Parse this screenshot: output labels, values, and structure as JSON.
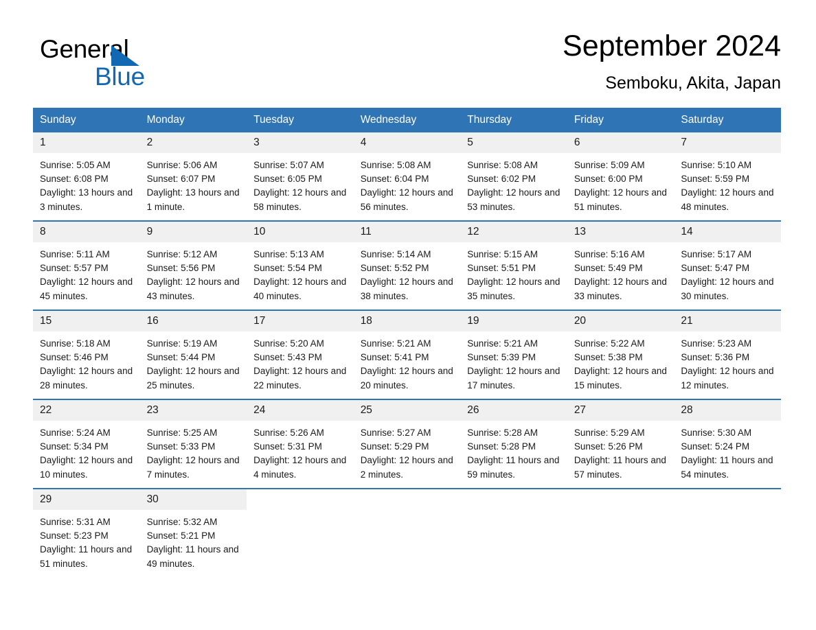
{
  "brand": {
    "name_part1": "General",
    "name_part2": "Blue",
    "triangle_icon": "triangle-icon",
    "accent_color": "#1268b3"
  },
  "header": {
    "title": "September 2024",
    "location": "Semboku, Akita, Japan"
  },
  "theme": {
    "header_bg": "#2f74b5",
    "header_text": "#ffffff",
    "daynum_bg": "#f0f0f0",
    "separator": "#2f74b5"
  },
  "weekdays": [
    "Sunday",
    "Monday",
    "Tuesday",
    "Wednesday",
    "Thursday",
    "Friday",
    "Saturday"
  ],
  "weeks": [
    [
      {
        "day": "1",
        "sunrise": "Sunrise: 5:05 AM",
        "sunset": "Sunset: 6:08 PM",
        "daylight": "Daylight: 13 hours and 3 minutes."
      },
      {
        "day": "2",
        "sunrise": "Sunrise: 5:06 AM",
        "sunset": "Sunset: 6:07 PM",
        "daylight": "Daylight: 13 hours and 1 minute."
      },
      {
        "day": "3",
        "sunrise": "Sunrise: 5:07 AM",
        "sunset": "Sunset: 6:05 PM",
        "daylight": "Daylight: 12 hours and 58 minutes."
      },
      {
        "day": "4",
        "sunrise": "Sunrise: 5:08 AM",
        "sunset": "Sunset: 6:04 PM",
        "daylight": "Daylight: 12 hours and 56 minutes."
      },
      {
        "day": "5",
        "sunrise": "Sunrise: 5:08 AM",
        "sunset": "Sunset: 6:02 PM",
        "daylight": "Daylight: 12 hours and 53 minutes."
      },
      {
        "day": "6",
        "sunrise": "Sunrise: 5:09 AM",
        "sunset": "Sunset: 6:00 PM",
        "daylight": "Daylight: 12 hours and 51 minutes."
      },
      {
        "day": "7",
        "sunrise": "Sunrise: 5:10 AM",
        "sunset": "Sunset: 5:59 PM",
        "daylight": "Daylight: 12 hours and 48 minutes."
      }
    ],
    [
      {
        "day": "8",
        "sunrise": "Sunrise: 5:11 AM",
        "sunset": "Sunset: 5:57 PM",
        "daylight": "Daylight: 12 hours and 45 minutes."
      },
      {
        "day": "9",
        "sunrise": "Sunrise: 5:12 AM",
        "sunset": "Sunset: 5:56 PM",
        "daylight": "Daylight: 12 hours and 43 minutes."
      },
      {
        "day": "10",
        "sunrise": "Sunrise: 5:13 AM",
        "sunset": "Sunset: 5:54 PM",
        "daylight": "Daylight: 12 hours and 40 minutes."
      },
      {
        "day": "11",
        "sunrise": "Sunrise: 5:14 AM",
        "sunset": "Sunset: 5:52 PM",
        "daylight": "Daylight: 12 hours and 38 minutes."
      },
      {
        "day": "12",
        "sunrise": "Sunrise: 5:15 AM",
        "sunset": "Sunset: 5:51 PM",
        "daylight": "Daylight: 12 hours and 35 minutes."
      },
      {
        "day": "13",
        "sunrise": "Sunrise: 5:16 AM",
        "sunset": "Sunset: 5:49 PM",
        "daylight": "Daylight: 12 hours and 33 minutes."
      },
      {
        "day": "14",
        "sunrise": "Sunrise: 5:17 AM",
        "sunset": "Sunset: 5:47 PM",
        "daylight": "Daylight: 12 hours and 30 minutes."
      }
    ],
    [
      {
        "day": "15",
        "sunrise": "Sunrise: 5:18 AM",
        "sunset": "Sunset: 5:46 PM",
        "daylight": "Daylight: 12 hours and 28 minutes."
      },
      {
        "day": "16",
        "sunrise": "Sunrise: 5:19 AM",
        "sunset": "Sunset: 5:44 PM",
        "daylight": "Daylight: 12 hours and 25 minutes."
      },
      {
        "day": "17",
        "sunrise": "Sunrise: 5:20 AM",
        "sunset": "Sunset: 5:43 PM",
        "daylight": "Daylight: 12 hours and 22 minutes."
      },
      {
        "day": "18",
        "sunrise": "Sunrise: 5:21 AM",
        "sunset": "Sunset: 5:41 PM",
        "daylight": "Daylight: 12 hours and 20 minutes."
      },
      {
        "day": "19",
        "sunrise": "Sunrise: 5:21 AM",
        "sunset": "Sunset: 5:39 PM",
        "daylight": "Daylight: 12 hours and 17 minutes."
      },
      {
        "day": "20",
        "sunrise": "Sunrise: 5:22 AM",
        "sunset": "Sunset: 5:38 PM",
        "daylight": "Daylight: 12 hours and 15 minutes."
      },
      {
        "day": "21",
        "sunrise": "Sunrise: 5:23 AM",
        "sunset": "Sunset: 5:36 PM",
        "daylight": "Daylight: 12 hours and 12 minutes."
      }
    ],
    [
      {
        "day": "22",
        "sunrise": "Sunrise: 5:24 AM",
        "sunset": "Sunset: 5:34 PM",
        "daylight": "Daylight: 12 hours and 10 minutes."
      },
      {
        "day": "23",
        "sunrise": "Sunrise: 5:25 AM",
        "sunset": "Sunset: 5:33 PM",
        "daylight": "Daylight: 12 hours and 7 minutes."
      },
      {
        "day": "24",
        "sunrise": "Sunrise: 5:26 AM",
        "sunset": "Sunset: 5:31 PM",
        "daylight": "Daylight: 12 hours and 4 minutes."
      },
      {
        "day": "25",
        "sunrise": "Sunrise: 5:27 AM",
        "sunset": "Sunset: 5:29 PM",
        "daylight": "Daylight: 12 hours and 2 minutes."
      },
      {
        "day": "26",
        "sunrise": "Sunrise: 5:28 AM",
        "sunset": "Sunset: 5:28 PM",
        "daylight": "Daylight: 11 hours and 59 minutes."
      },
      {
        "day": "27",
        "sunrise": "Sunrise: 5:29 AM",
        "sunset": "Sunset: 5:26 PM",
        "daylight": "Daylight: 11 hours and 57 minutes."
      },
      {
        "day": "28",
        "sunrise": "Sunrise: 5:30 AM",
        "sunset": "Sunset: 5:24 PM",
        "daylight": "Daylight: 11 hours and 54 minutes."
      }
    ],
    [
      {
        "day": "29",
        "sunrise": "Sunrise: 5:31 AM",
        "sunset": "Sunset: 5:23 PM",
        "daylight": "Daylight: 11 hours and 51 minutes."
      },
      {
        "day": "30",
        "sunrise": "Sunrise: 5:32 AM",
        "sunset": "Sunset: 5:21 PM",
        "daylight": "Daylight: 11 hours and 49 minutes."
      },
      null,
      null,
      null,
      null,
      null
    ]
  ]
}
